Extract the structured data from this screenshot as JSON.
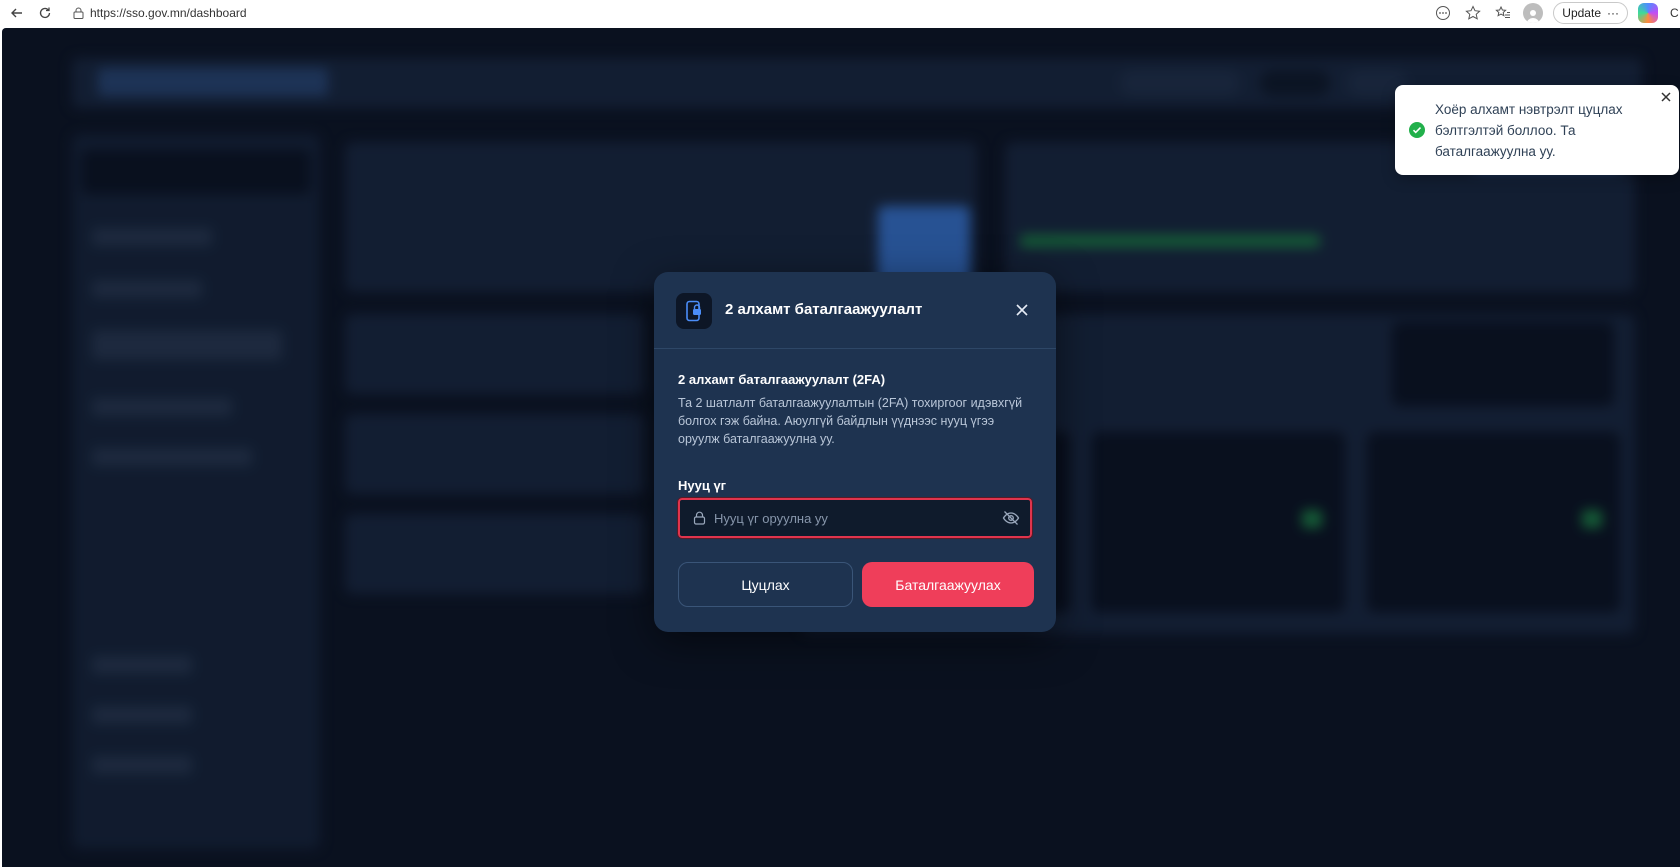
{
  "browser": {
    "url": "https://sso.gov.mn/dashboard",
    "update_label": "Update",
    "edge_text": "C"
  },
  "modal": {
    "title": "2 алхамт баталгаажуулалт",
    "section_title": "2 алхамт баталгаажуулалт (2FA)",
    "description": "Та 2 шатлалт баталгаажуулалтын (2FA) тохиргоог идэвхгүй болгох гэж байна. Аюулгүй байдлын үүднээс нууц үгээ оруулж баталгаажуулна уу.",
    "password_label": "Нууц үг",
    "password_placeholder": "Нууц үг оруулна уу",
    "password_value": "",
    "cancel_label": "Цуцлах",
    "confirm_label": "Баталгаажуулах"
  },
  "toast": {
    "message": "Хоёр алхамт нэвтрэлт цуцлах бэлтгэлтэй боллоо. Та баталгаажуулна уу.",
    "status": "success",
    "status_color": "#22b04b"
  },
  "colors": {
    "accent": "#ef3e5a",
    "modal_bg": "#1e3350",
    "page_bg": "#0d1626"
  }
}
